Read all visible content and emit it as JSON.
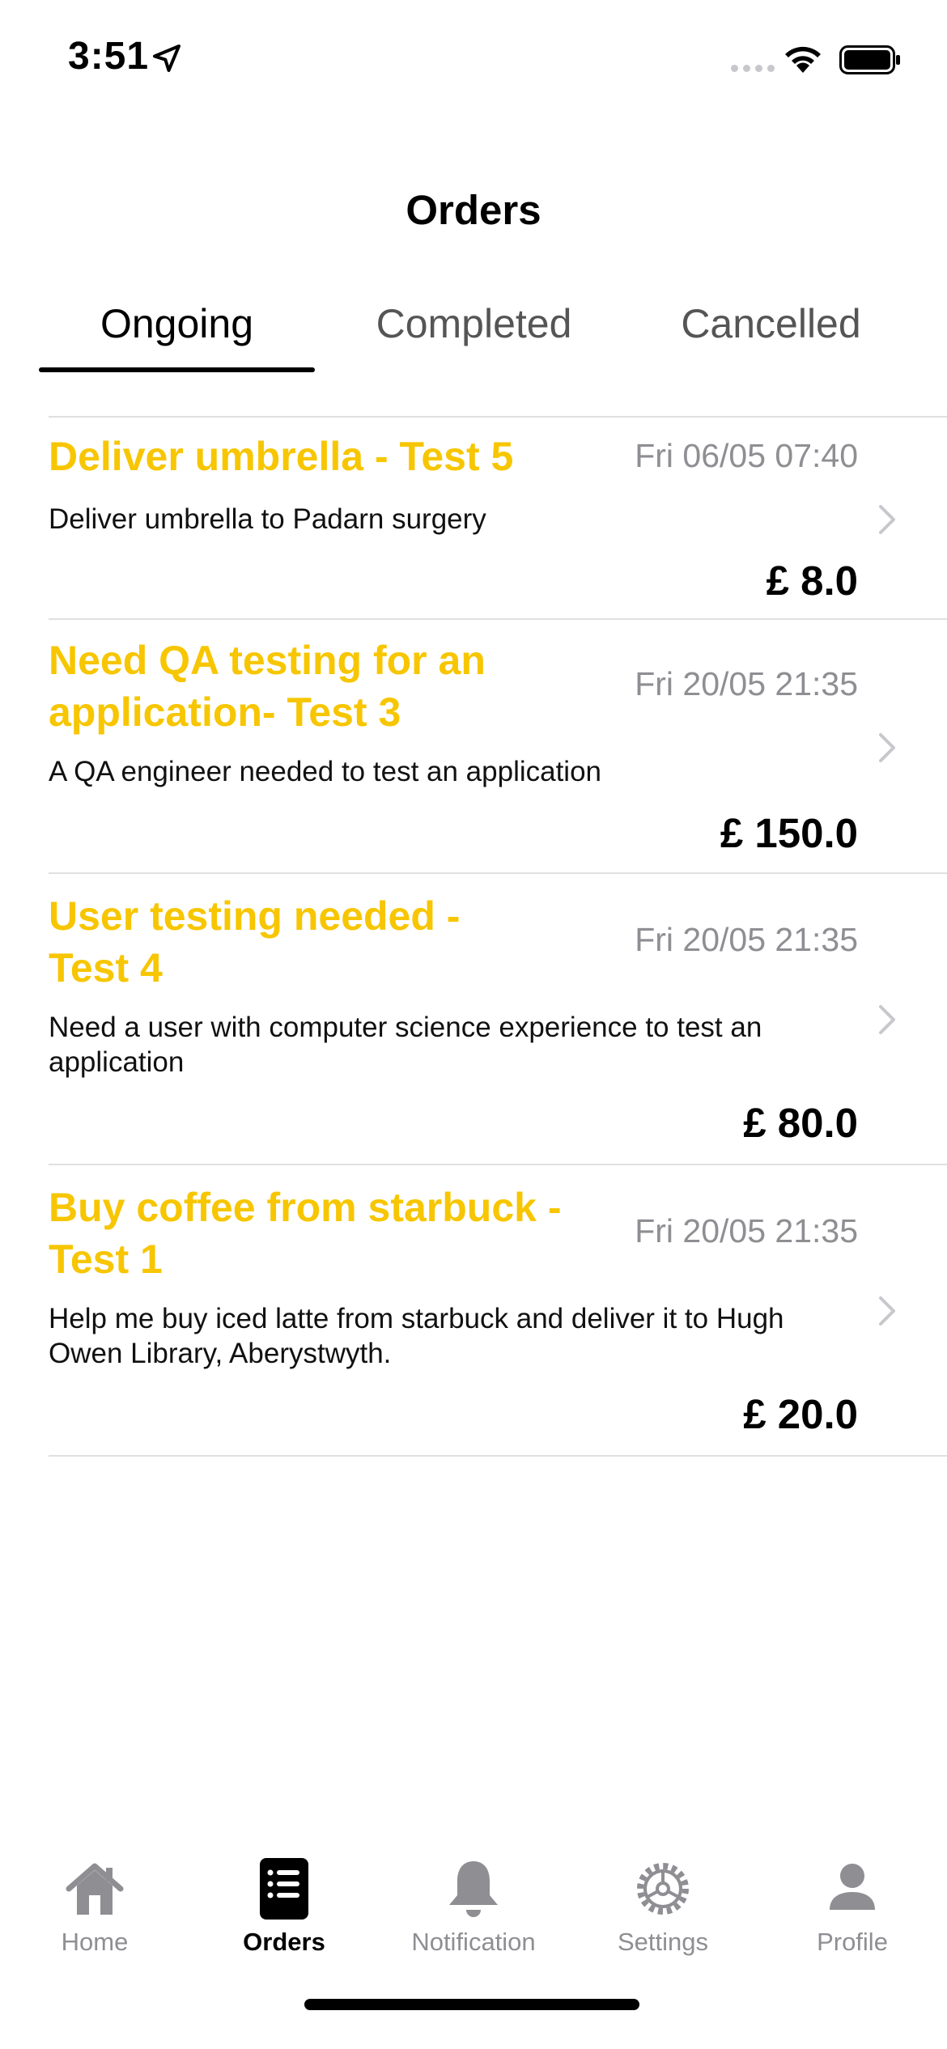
{
  "status": {
    "time": "3:51"
  },
  "header": {
    "title": "Orders"
  },
  "tabs": [
    {
      "label": "Ongoing",
      "active": true
    },
    {
      "label": "Completed",
      "active": false
    },
    {
      "label": "Cancelled",
      "active": false
    }
  ],
  "orders": [
    {
      "title": "Deliver umbrella - Test 5",
      "date": "Fri 06/05 07:40",
      "description": "Deliver umbrella to Padarn surgery",
      "price": "£ 8.0"
    },
    {
      "title": "Need QA testing for an application- Test 3",
      "date": "Fri 20/05 21:35",
      "description": "A QA engineer needed to test an application",
      "price": "£ 150.0"
    },
    {
      "title": "User testing needed - Test 4",
      "date": "Fri 20/05 21:35",
      "description": "Need a user with computer science experience to test an application",
      "price": "£ 80.0"
    },
    {
      "title": "Buy coffee from starbuck - Test 1",
      "date": "Fri 20/05 21:35",
      "description": "Help me buy iced latte from starbuck and deliver it to Hugh Owen Library, Aberystwyth.",
      "price": "£ 20.0"
    }
  ],
  "tabbar": [
    {
      "label": "Home",
      "icon": "home-icon",
      "active": false
    },
    {
      "label": "Orders",
      "icon": "orders-icon",
      "active": true
    },
    {
      "label": "Notification",
      "icon": "bell-icon",
      "active": false
    },
    {
      "label": "Settings",
      "icon": "gear-icon",
      "active": false
    },
    {
      "label": "Profile",
      "icon": "person-icon",
      "active": false
    }
  ],
  "colors": {
    "accent": "#f7c600",
    "secondary_text": "#8e8e93",
    "divider": "#e0e0e0"
  }
}
